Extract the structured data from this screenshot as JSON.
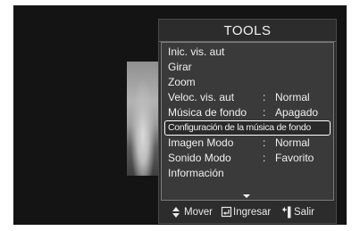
{
  "panel": {
    "title": "TOOLS"
  },
  "menu": {
    "items": [
      {
        "label": "Inic. vis. aut",
        "separator": "",
        "value": ""
      },
      {
        "label": "Girar",
        "separator": "",
        "value": ""
      },
      {
        "label": "Zoom",
        "separator": "",
        "value": ""
      },
      {
        "label": "Veloc. vis. aut",
        "separator": ":",
        "value": "Normal"
      },
      {
        "label": "Música de fondo",
        "separator": ":",
        "value": "Apagado"
      },
      {
        "label": "Configuración de la música de fondo",
        "separator": "",
        "value": "",
        "selected": true
      },
      {
        "label": "Imagen Modo",
        "separator": ":",
        "value": "Normal"
      },
      {
        "label": "Sonido Modo",
        "separator": ":",
        "value": "Favorito"
      },
      {
        "label": "Información",
        "separator": "",
        "value": ""
      }
    ]
  },
  "footer": {
    "move_label": "Mover",
    "enter_label": "Ingresar",
    "exit_label": "Salir",
    "move_icon": "up-down-arrow-icon",
    "enter_icon": "enter-icon",
    "exit_icon": "return-icon"
  },
  "colors": {
    "panel_bg": "#2c2c2c",
    "menu_bg": "#3a3a3a",
    "text": "#f0f0f0",
    "selection_border": "#ffffff"
  }
}
